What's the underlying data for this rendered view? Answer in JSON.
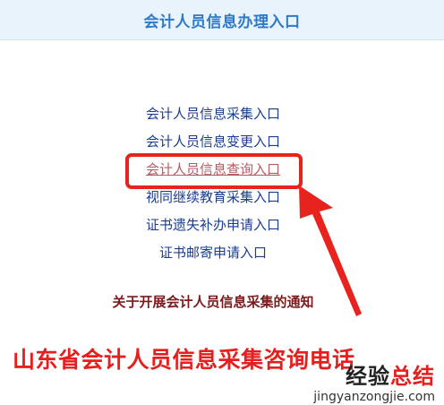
{
  "header": {
    "title": "会计人员信息办理入口"
  },
  "links": [
    {
      "label": "会计人员信息采集入口"
    },
    {
      "label": "会计人员信息变更入口"
    },
    {
      "label": "会计人员信息查询入口"
    },
    {
      "label": "视同继续教育采集入口"
    },
    {
      "label": "证书遗失补办申请入口"
    },
    {
      "label": "证书邮寄申请入口"
    }
  ],
  "notice": {
    "label": "关于开展会计人员信息采集的通知"
  },
  "caption": {
    "text": "山东省会计人员信息采集咨询电话"
  },
  "watermark": {
    "cn_part1": "经验",
    "cn_part2": "总结",
    "url": "jingyanzongjie.com"
  },
  "colors": {
    "header_bg": "#e9f3fb",
    "header_text": "#2f79c7",
    "link": "#1b3d8f",
    "link_highlighted": "#b75b62",
    "highlight_border": "#e8231d",
    "notice": "#7a1a1a",
    "caption": "#e61e1e"
  },
  "icons": [
    "red-arrow-icon"
  ]
}
